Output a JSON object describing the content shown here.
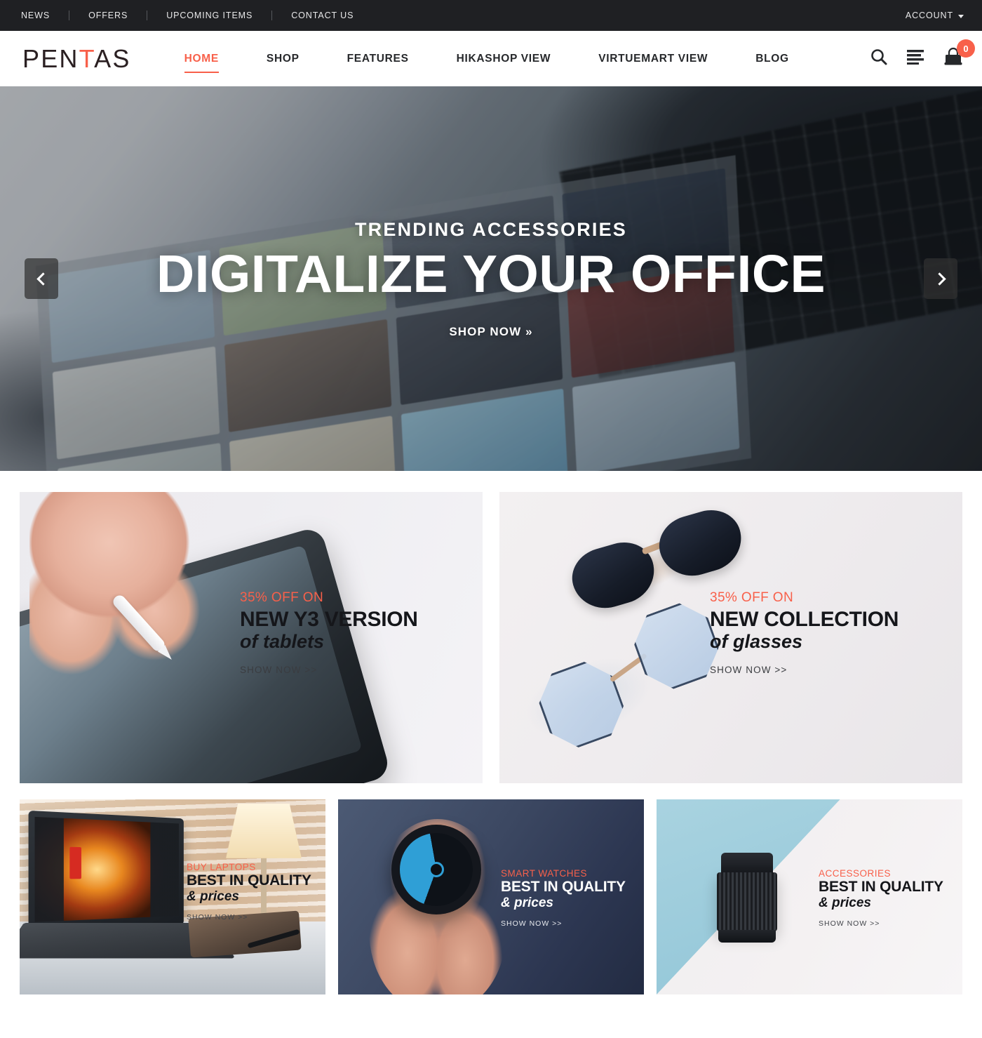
{
  "topbar": {
    "links": [
      {
        "label": "NEWS"
      },
      {
        "label": "OFFERS"
      },
      {
        "label": "UPCOMING ITEMS"
      },
      {
        "label": "CONTACT US"
      }
    ],
    "account_label": "ACCOUNT",
    "caret_icon": "chevron-down-icon",
    "background": "#1f2023"
  },
  "header": {
    "logo_part1": "PEN",
    "logo_accent": "T",
    "logo_part2": "AS",
    "accent_color": "#f8604a",
    "nav": [
      {
        "label": "HOME",
        "active": true
      },
      {
        "label": "SHOP",
        "active": false
      },
      {
        "label": "FEATURES",
        "active": false
      },
      {
        "label": "HIKASHOP VIEW",
        "active": false
      },
      {
        "label": "VIRTUEMART VIEW",
        "active": false
      },
      {
        "label": "BLOG",
        "active": false
      }
    ],
    "tools": {
      "search_icon": "search-icon",
      "menu_icon": "list-menu-icon",
      "cart_icon": "shopping-bag-icon",
      "cart_count": "0"
    }
  },
  "hero": {
    "subtitle": "TRENDING ACCESSORIES",
    "title": "DIGITALIZE YOUR OFFICE",
    "cta": "SHOP NOW »",
    "prev_icon": "chevron-left-icon",
    "next_icon": "chevron-right-icon"
  },
  "promos_large": [
    {
      "kicker": "35% OFF ON",
      "headline": "NEW Y3 VERSION",
      "subline": "of tablets",
      "cta": "SHOW NOW >>",
      "art": "tablet-with-stylus"
    },
    {
      "kicker": "35% OFF ON",
      "headline": "NEW COLLECTION",
      "subline": "of glasses",
      "cta": "SHOW NOW >>",
      "art": "sunglasses-and-eyeglasses"
    }
  ],
  "promos_small": [
    {
      "kicker": "BUY LAPTOPS",
      "headline": "BEST IN QUALITY",
      "subline": "& prices",
      "cta": "SHOW NOW >>",
      "art": "laptop-on-desk"
    },
    {
      "kicker": "SMART WATCHES",
      "headline": "BEST IN QUALITY",
      "subline": "& prices",
      "cta": "SHOW NOW >>",
      "art": "hand-holding-watch"
    },
    {
      "kicker": "ACCESSORIES",
      "headline": "BEST IN QUALITY",
      "subline": "& prices",
      "cta": "SHOW NOW >>",
      "art": "camera-lens"
    }
  ]
}
